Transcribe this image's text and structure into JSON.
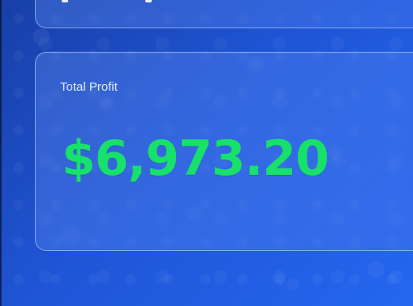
{
  "summary": {
    "total_profit_label": "Total Profit",
    "total_profit_value": "$6,973.20",
    "profit_color": "#17e06b"
  }
}
